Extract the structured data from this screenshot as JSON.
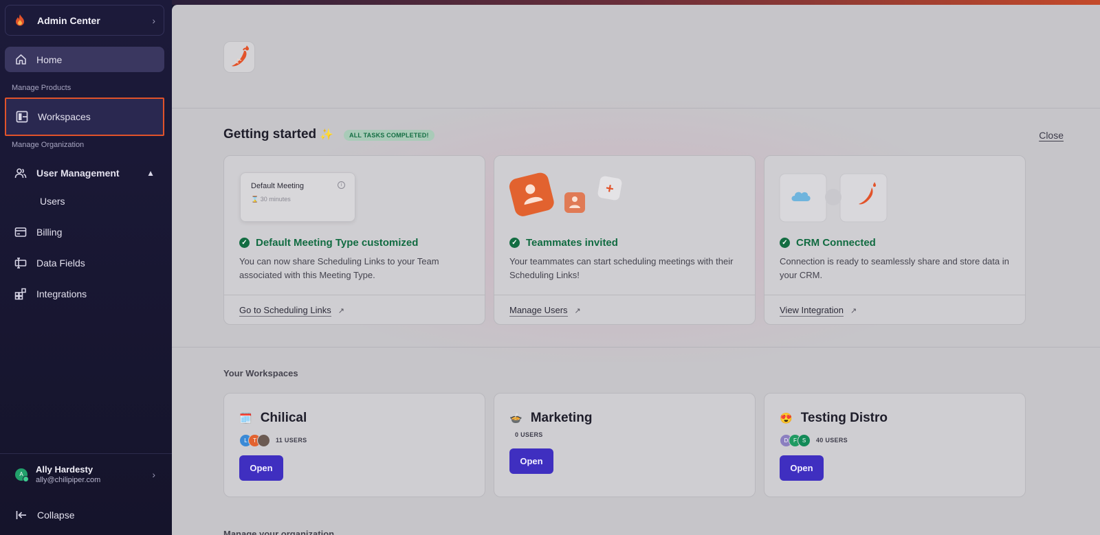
{
  "sidebar": {
    "admin_title": "Admin Center",
    "home": "Home",
    "section_products": "Manage Products",
    "workspaces": "Workspaces",
    "section_org": "Manage Organization",
    "user_management": "User Management",
    "users": "Users",
    "billing": "Billing",
    "data_fields": "Data Fields",
    "integrations": "Integrations",
    "user": {
      "name": "Ally Hardesty",
      "email": "ally@chilipiper.com",
      "initial": "A"
    },
    "collapse": "Collapse"
  },
  "getting_started": {
    "title": "Getting started",
    "badge": "ALL TASKS COMPLETED!",
    "close": "Close",
    "tasks": [
      {
        "title": "Default Meeting Type customized",
        "description": "You can now share Scheduling Links to your Team associated with this Meeting Type.",
        "link": "Go to Scheduling Links",
        "preview_title": "Default Meeting",
        "preview_sub": "30 minutes"
      },
      {
        "title": "Teammates invited",
        "description": "Your teammates can start scheduling meetings with their Scheduling Links!",
        "link": "Manage Users"
      },
      {
        "title": "CRM Connected",
        "description": "Connection is ready to seamlessly share and store data in your CRM.",
        "link": "View Integration"
      }
    ]
  },
  "workspaces": {
    "label": "Your Workspaces",
    "open_label": "Open",
    "items": [
      {
        "emoji": "🗓️",
        "name": "Chilical",
        "users": "11 USERS",
        "avatars": [
          "L",
          "T",
          ""
        ]
      },
      {
        "emoji": "🍲",
        "name": "Marketing",
        "users": "0 USERS",
        "avatars": []
      },
      {
        "emoji": "😍",
        "name": "Testing Distro",
        "users": "40 USERS",
        "avatars": [
          "D",
          "F",
          "S"
        ]
      }
    ]
  },
  "manage_org_label": "Manage your organization",
  "colors": {
    "accent": "#3f2fc0",
    "brand": "#e2532a",
    "success": "#136d42"
  }
}
